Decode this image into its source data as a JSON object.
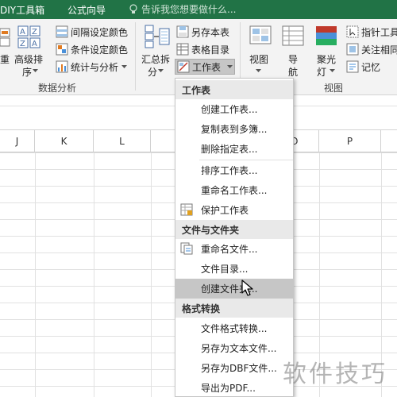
{
  "tabs": {
    "diy": "DIY工具箱",
    "formula_wizard": "公式向导",
    "tell_me": "告诉我您想要做什么..."
  },
  "ribbon": {
    "sort_partial": "重",
    "advanced_sort_line1": "高级排",
    "advanced_sort_line2": "序",
    "interval_color": "间隔设定颜色",
    "conditional_color": "条件设定颜色",
    "stats_analysis": "统计与分析",
    "data_analysis_group": "数据分析",
    "summarize_line1": "汇总拆",
    "summarize_line2": "分",
    "save_as_book": "另存本表",
    "table_directory": "表格目录",
    "worksheet": "工作表",
    "view": "视图",
    "navigation_line1": "导",
    "navigation_line2": "航",
    "spotlight_line1": "聚光",
    "spotlight_line2": "灯",
    "pointer_tool": "指针工具",
    "focus_same": "关注相同",
    "memory": "记忆",
    "view_group": "视图"
  },
  "columns": [
    "J",
    "K",
    "L",
    "O",
    "P"
  ],
  "menu": {
    "sections": [
      {
        "header": "工作表",
        "items": [
          {
            "label": "创建工作表...",
            "icon": ""
          },
          {
            "label": "复制表到多簿...",
            "icon": ""
          },
          {
            "label": "删除指定表...",
            "icon": ""
          },
          {
            "label": "排序工作表...",
            "icon": ""
          },
          {
            "label": "重命名工作表...",
            "icon": ""
          },
          {
            "label": "保护工作表",
            "icon": "protect-sheet-icon"
          }
        ]
      },
      {
        "header": "文件与文件夹",
        "items": [
          {
            "label": "重命名文件...",
            "icon": "rename-files-icon"
          },
          {
            "label": "文件目录...",
            "icon": ""
          },
          {
            "label": "创建文件夹...",
            "icon": ""
          }
        ]
      },
      {
        "header": "格式转换",
        "items": [
          {
            "label": "文件格式转换...",
            "icon": ""
          },
          {
            "label": "另存为文本文件...",
            "icon": ""
          },
          {
            "label": "另存为DBF文件...",
            "icon": ""
          },
          {
            "label": "导出为PDF...",
            "icon": ""
          }
        ]
      }
    ]
  },
  "watermark": "软件技巧",
  "colors": {
    "tab_bar": "#217346",
    "ribbon_bg": "#f3f3f3",
    "menu_header_bg": "#e9e9e9",
    "menu_hover_bg": "#c6c6c6"
  }
}
